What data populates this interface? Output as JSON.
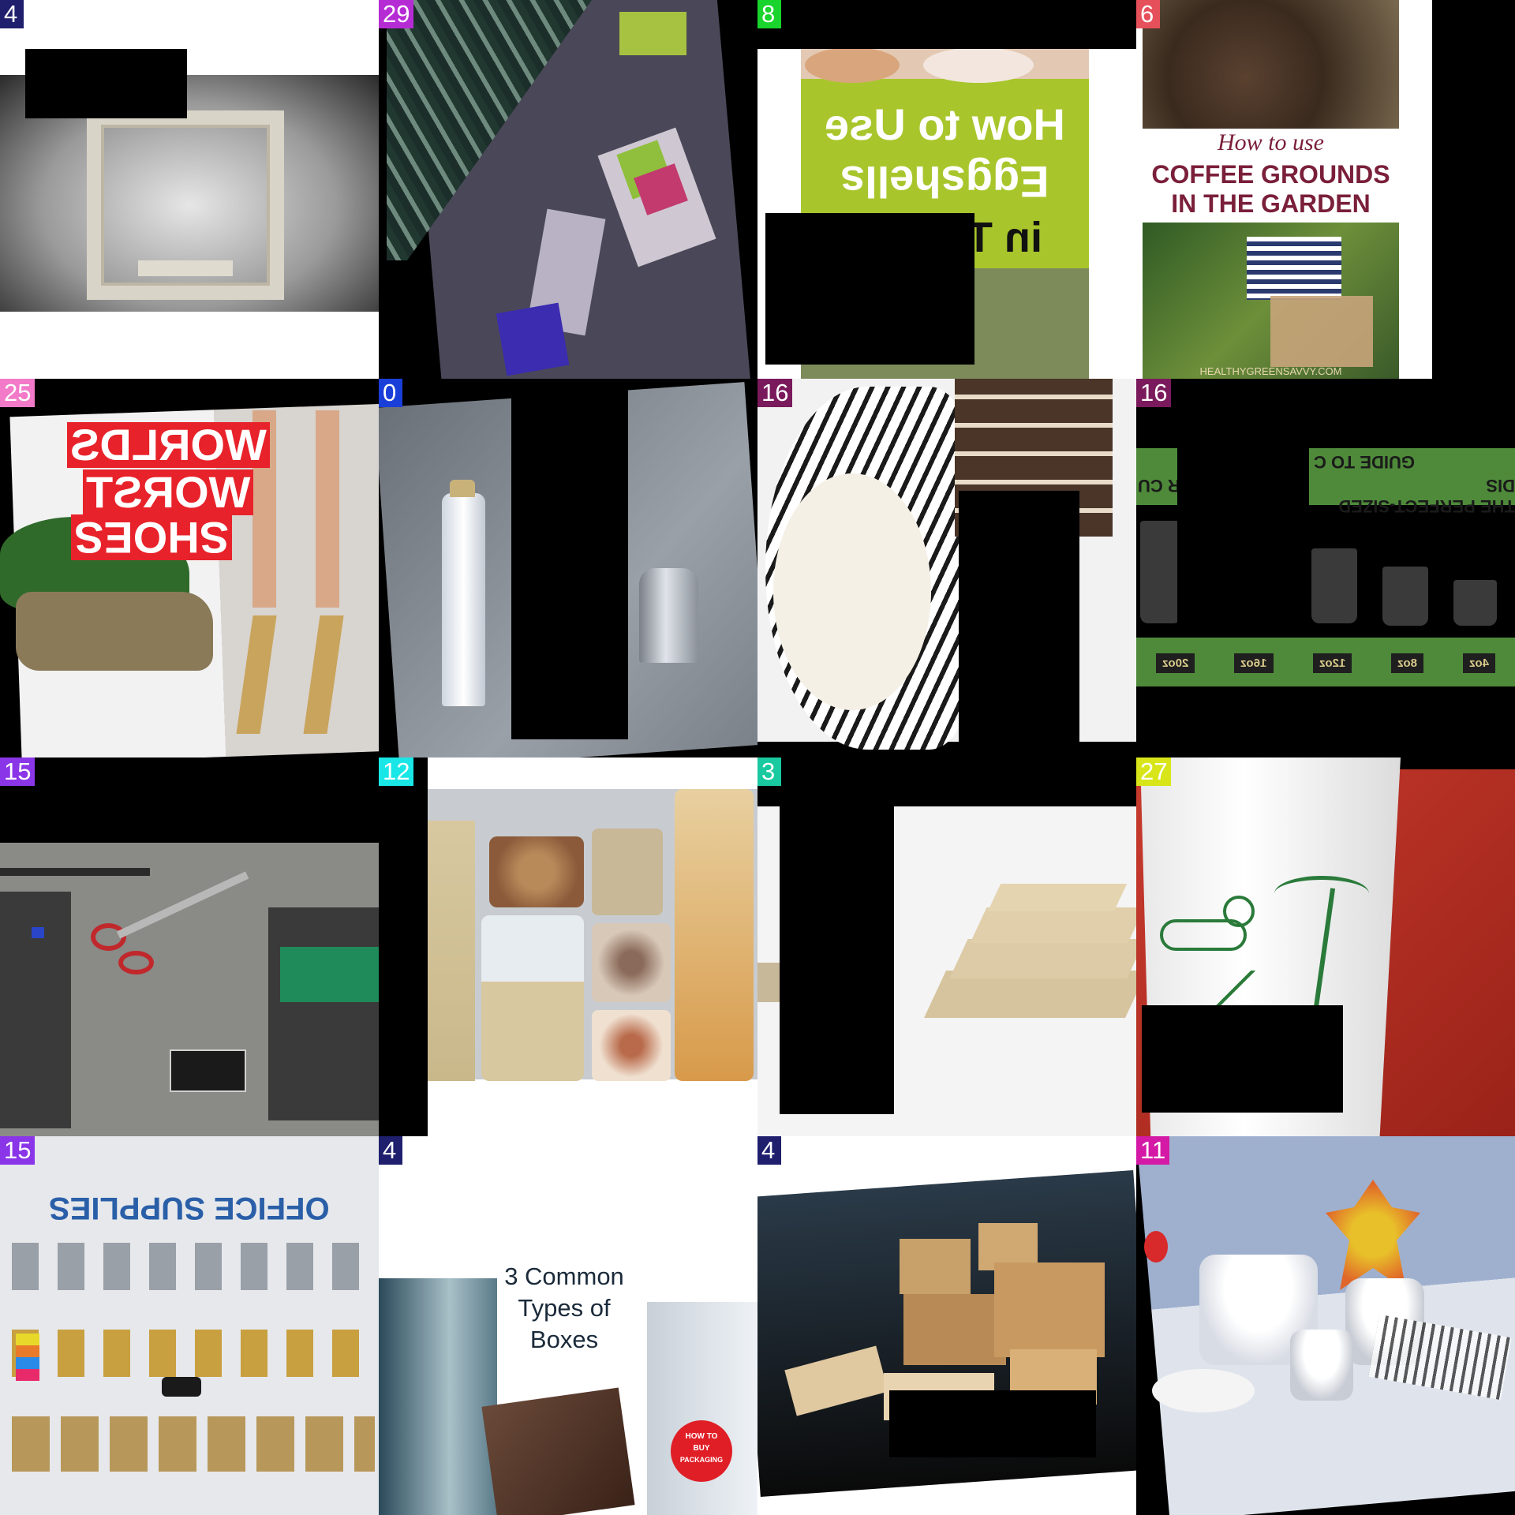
{
  "tiles": [
    {
      "id": "t0",
      "badge": "4",
      "badge_color": "#1f1f6e"
    },
    {
      "id": "t1",
      "badge": "29",
      "badge_color": "#b62cd4"
    },
    {
      "id": "t2",
      "badge": "8",
      "badge_color": "#19d42c"
    },
    {
      "id": "t3",
      "badge": "6",
      "badge_color": "#e6505a",
      "title_script": "How to use",
      "title_line1": "COFFEE GROUNDS",
      "title_line2": "IN THE GARDEN",
      "footer": "HEALTHYGREENSAVVY.COM"
    },
    {
      "id": "t4",
      "badge": "25",
      "badge_color": "#f27ac8",
      "line1": "WORLDS",
      "line2": "WORST",
      "line3": "SHOES"
    },
    {
      "id": "t5",
      "badge": "0",
      "badge_color": "#1a3fd9"
    },
    {
      "id": "t6",
      "badge": "16",
      "badge_color": "#7a1a5c"
    },
    {
      "id": "t7",
      "badge": "16",
      "badge_color": "#7a1a5c",
      "head1": "GUIDE TO C",
      "head2": "THE PERFECT-SIZED DIS",
      "head_left": "R CU",
      "sizes": [
        "20oz",
        "16oz",
        "12oz",
        "8oz",
        "4oz"
      ]
    },
    {
      "id": "t8",
      "badge": "15",
      "badge_color": "#8a35e8"
    },
    {
      "id": "t9",
      "badge": "12",
      "badge_color": "#19e6e6"
    },
    {
      "id": "t10",
      "badge": "3",
      "badge_color": "#19c9a0"
    },
    {
      "id": "t11",
      "badge": "27",
      "badge_color": "#d8e619"
    },
    {
      "id": "t12",
      "badge": "15",
      "badge_color": "#8a35e8",
      "title": "OFFICE SUPPLIES"
    },
    {
      "id": "t13",
      "badge": "4",
      "badge_color": "#1f1f6e",
      "line1": "3 Common",
      "line2": "Types of",
      "line3": "Boxes",
      "seal1": "HOW TO",
      "seal2": "BUY",
      "seal3": "PACKAGING"
    },
    {
      "id": "t14",
      "badge": "4",
      "badge_color": "#1f1f6e"
    },
    {
      "id": "t15",
      "badge": "11",
      "badge_color": "#d419a6"
    }
  ],
  "t2_title1": "How to Use",
  "t2_title2": "Eggshells",
  "t2_title3": "in T",
  "colors": {
    "mask": "#000000",
    "lime": "#a8c62c",
    "guide_green": "#4e8a3a",
    "coffee_text": "#7a1f3a",
    "shoes_red": "#e8222a",
    "red_bg": "#b3261e"
  }
}
